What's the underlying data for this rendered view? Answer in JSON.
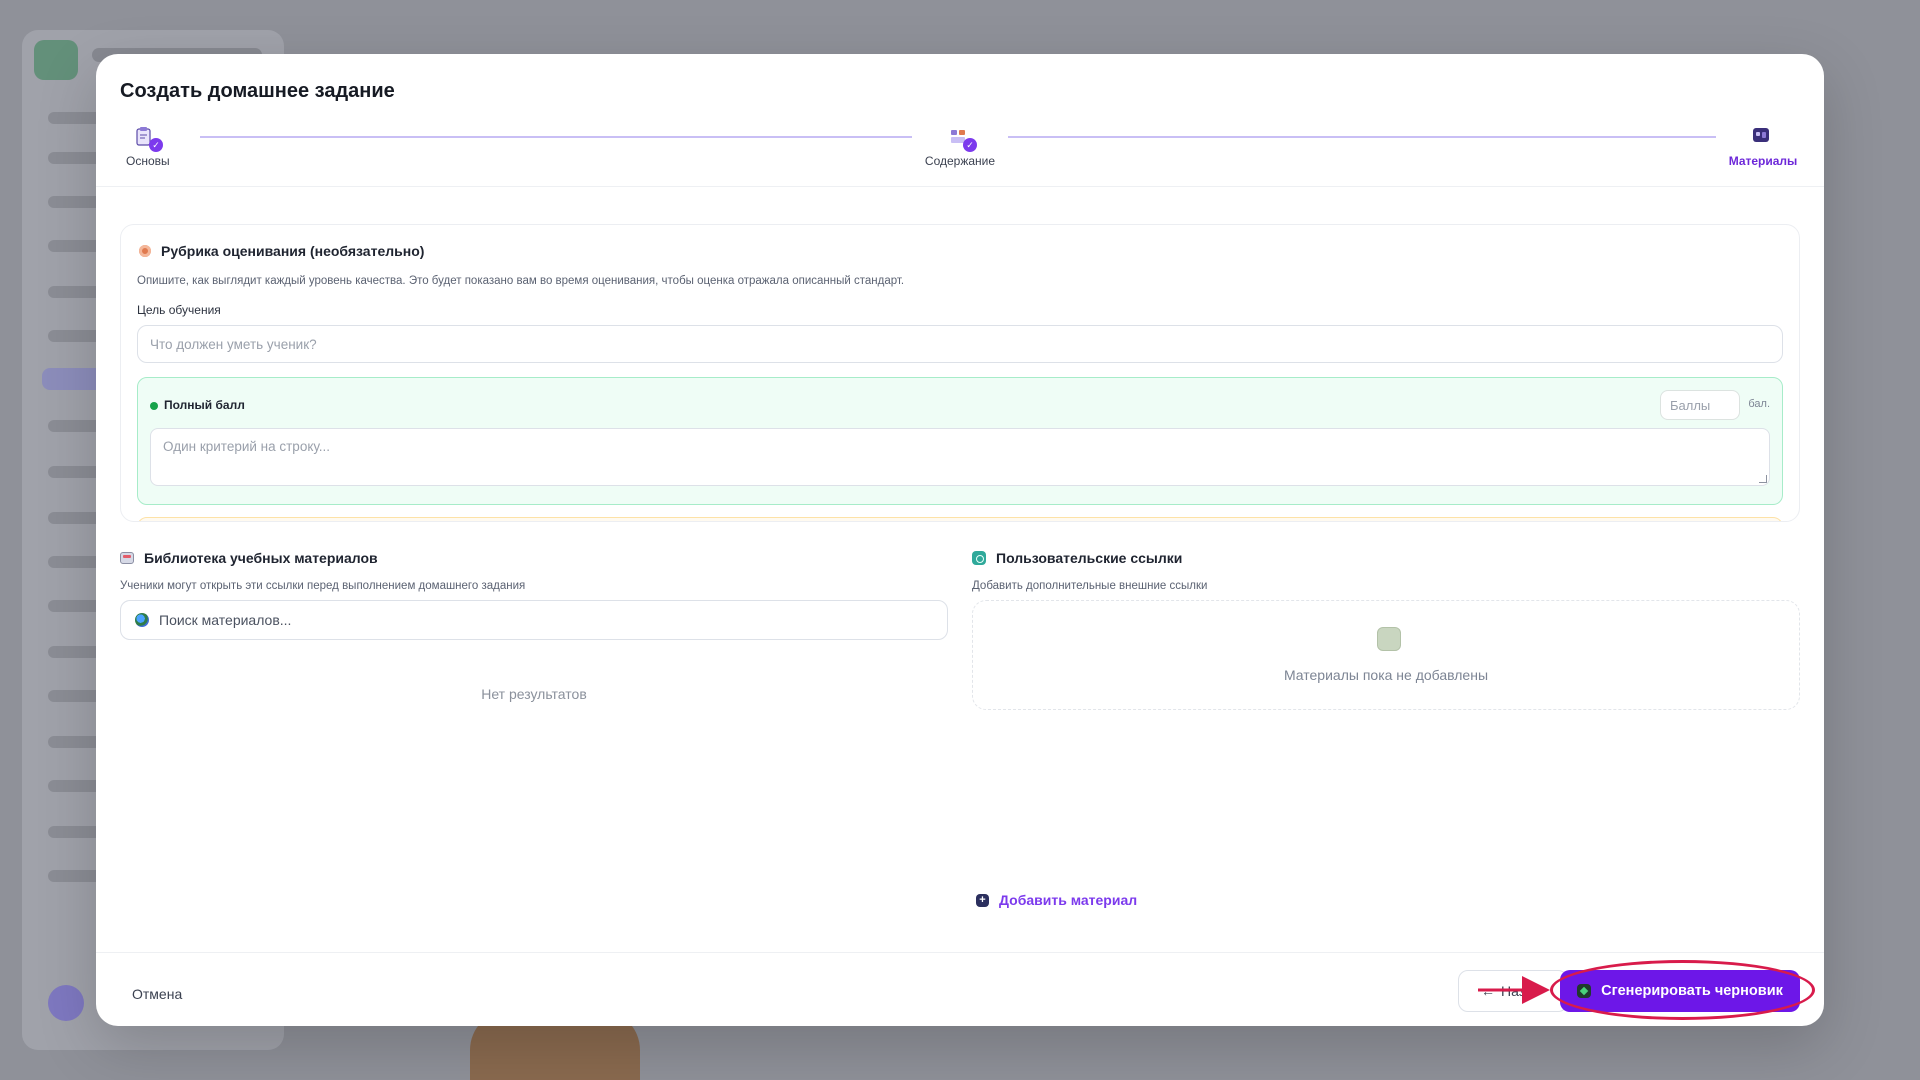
{
  "modal": {
    "title": "Создать домашнее задание"
  },
  "stepper": {
    "steps": [
      {
        "label": "Основы",
        "state": "completed"
      },
      {
        "label": "Содержание",
        "state": "completed"
      },
      {
        "label": "Материалы",
        "state": "current"
      }
    ]
  },
  "rubric": {
    "title": "Рубрика оценивания (необязательно)",
    "description": "Опишите, как выглядит каждый уровень качества. Это будет показано вам во время оценивания, чтобы оценка отражала описанный стандарт.",
    "goal_label": "Цель обучения",
    "goal_placeholder": "Что должен уметь ученик?",
    "levels": [
      {
        "name": "Полный балл",
        "points_placeholder": "Баллы",
        "points_unit": "бал.",
        "criteria_placeholder": "Один критерий на строку...",
        "color": "#16a34a"
      }
    ]
  },
  "library": {
    "title": "Библиотека учебных материалов",
    "description": "Ученики могут открыть эти ссылки перед выполнением домашнего задания",
    "search_placeholder": "Поиск материалов...",
    "no_results": "Нет результатов"
  },
  "custom_links": {
    "title": "Пользовательские ссылки",
    "description": "Добавить дополнительные внешние ссылки",
    "empty_text": "Материалы пока не добавлены",
    "add_label": "Добавить материал"
  },
  "footer": {
    "cancel_label": "Отмена",
    "back_label": "Наз",
    "generate_label": "Сгенерировать черновик"
  },
  "colors": {
    "accent": "#7c3aed",
    "primary_button": "#6d17e8",
    "annotation": "#d81b4b"
  }
}
